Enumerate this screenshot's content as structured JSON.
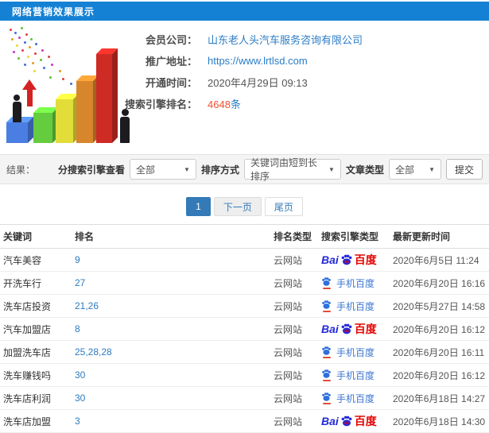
{
  "header": {
    "title": "网络营销效果展示"
  },
  "account": {
    "company": {
      "label": "会员公司：",
      "value": "山东老人头汽车服务咨询有限公司"
    },
    "site": {
      "label": "推广地址：",
      "value": "https://www.lrtlsd.com"
    },
    "opened": {
      "label": "开通时间：",
      "value": "2020年4月29日 09:13"
    },
    "ranking": {
      "label": "搜索引擎排名：",
      "value": "4648",
      "suffix": "条"
    }
  },
  "filters": {
    "section_label": "结果：",
    "engine": {
      "label": "分搜索引擎查看",
      "value": "全部"
    },
    "sort": {
      "label": "排序方式",
      "value": "关键词由短到长排序"
    },
    "article": {
      "label": "文章类型",
      "value": "全部"
    },
    "caret": "▼",
    "submit_label": "提交"
  },
  "pagination": {
    "current": "1",
    "next": "下一页",
    "last": "尾页"
  },
  "table": {
    "columns": {
      "keyword": "关键词",
      "rank": "排名",
      "rank_type": "排名类型",
      "engine": "搜索引擎类型",
      "updated": "最新更新时间"
    },
    "baidu_logo": {
      "bai": "Bai",
      "cn": "百度"
    },
    "mobile_label": "手机百度",
    "rows": [
      {
        "keyword": "汽车美容",
        "rank": "9",
        "rank_type": "云网站",
        "engine": "baidu",
        "updated": "2020年6月5日 11:24"
      },
      {
        "keyword": "开洗车行",
        "rank": "27",
        "rank_type": "云网站",
        "engine": "mobile-baidu",
        "updated": "2020年6月20日 16:16"
      },
      {
        "keyword": "洗车店投资",
        "rank": "21,26",
        "rank_type": "云网站",
        "engine": "mobile-baidu",
        "updated": "2020年5月27日 14:58"
      },
      {
        "keyword": "汽车加盟店",
        "rank": "8",
        "rank_type": "云网站",
        "engine": "baidu",
        "updated": "2020年6月20日 16:12"
      },
      {
        "keyword": "加盟洗车店",
        "rank": "25,28,28",
        "rank_type": "云网站",
        "engine": "mobile-baidu",
        "updated": "2020年6月20日 16:11"
      },
      {
        "keyword": "洗车赚钱吗",
        "rank": "30",
        "rank_type": "云网站",
        "engine": "mobile-baidu",
        "updated": "2020年6月20日 16:12"
      },
      {
        "keyword": "洗车店利润",
        "rank": "30",
        "rank_type": "云网站",
        "engine": "mobile-baidu",
        "updated": "2020年6月18日 14:27"
      },
      {
        "keyword": "洗车店加盟",
        "rank": "3",
        "rank_type": "云网站",
        "engine": "baidu",
        "updated": "2020年6月18日 14:30"
      }
    ]
  }
}
